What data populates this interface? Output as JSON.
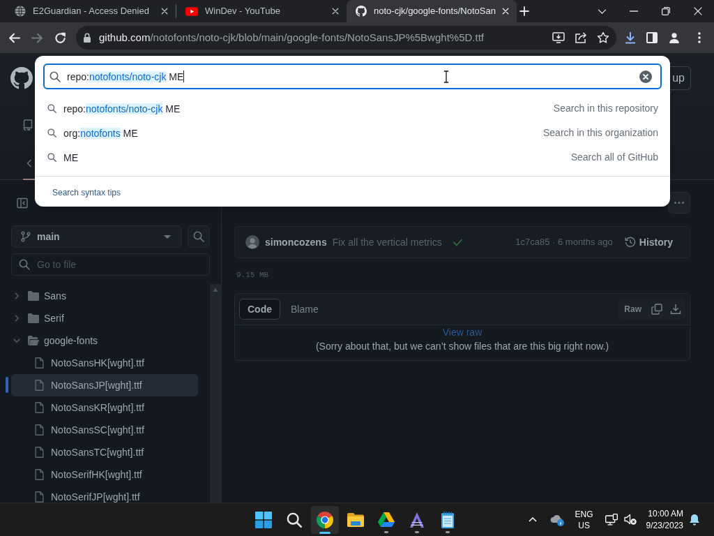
{
  "browser": {
    "tabs": [
      {
        "kind": "globe",
        "title": "E2Guardian - Access Denied",
        "selected": false
      },
      {
        "kind": "youtube",
        "title": "WinDev - YouTube",
        "selected": false
      },
      {
        "kind": "github",
        "title": "noto-cjk/google-fonts/NotoSan",
        "selected": true
      }
    ],
    "nav_buttons": [
      {
        "kind": "back",
        "disabled": false
      },
      {
        "kind": "forward",
        "disabled": true
      },
      {
        "kind": "reload",
        "disabled": false
      }
    ],
    "address": {
      "host": "github.com",
      "path": "/notofonts/noto-cjk/blob/main/google-fonts/NotoSansJP%5Bwght%5D.ttf"
    }
  },
  "header": {
    "signup_button": "up"
  },
  "search_popup": {
    "query_parts": [
      {
        "text": "repo:",
        "highlight": false
      },
      {
        "text": "notofonts/noto-cjk",
        "highlight": true
      },
      {
        "text": " ME",
        "highlight": false
      }
    ],
    "suggestions": [
      {
        "parts": [
          {
            "text": "repo:",
            "highlight": false
          },
          {
            "text": "notofonts/noto-cjk",
            "highlight": true
          },
          {
            "text": " ME",
            "highlight": false
          }
        ],
        "scope": "Search in this repository"
      },
      {
        "parts": [
          {
            "text": "org:",
            "highlight": false
          },
          {
            "text": "notofonts",
            "highlight": true
          },
          {
            "text": " ME",
            "highlight": false
          }
        ],
        "scope": "Search in this organization"
      },
      {
        "parts": [
          {
            "text": "ME",
            "highlight": false
          }
        ],
        "scope": "Search all of GitHub"
      }
    ],
    "syntax_tips": "Search syntax tips"
  },
  "sidebar": {
    "branch": "main",
    "file_filter": {
      "placeholder": "Go to file"
    },
    "tree": [
      {
        "kind": "folder",
        "name": "Sans",
        "expanded": false,
        "selected": false
      },
      {
        "kind": "folder",
        "name": "Serif",
        "expanded": false,
        "selected": false
      },
      {
        "kind": "folder",
        "name": "google-fonts",
        "expanded": true,
        "selected": false,
        "children": [
          {
            "kind": "file",
            "name": "NotoSansHK[wght].ttf",
            "selected": false
          },
          {
            "kind": "file",
            "name": "NotoSansJP[wght].ttf",
            "selected": true
          },
          {
            "kind": "file",
            "name": "NotoSansKR[wght].ttf",
            "selected": false
          },
          {
            "kind": "file",
            "name": "NotoSansSC[wght].ttf",
            "selected": false
          },
          {
            "kind": "file",
            "name": "NotoSansTC[wght].ttf",
            "selected": false
          },
          {
            "kind": "file",
            "name": "NotoSerifHK[wght].ttf",
            "selected": false
          },
          {
            "kind": "file",
            "name": "NotoSerifJP[wght].ttf",
            "selected": false
          }
        ]
      }
    ]
  },
  "file_view": {
    "commit": {
      "author": "simoncozens",
      "message": "Fix all the vertical metrics",
      "passed": true,
      "info": "1c7ca85 · 6 months ago",
      "history": "History"
    },
    "size": "9.15 MB",
    "view_tabs": [
      {
        "label": "Code",
        "selected": true
      },
      {
        "label": "Blame",
        "selected": false
      }
    ],
    "raw_button": "Raw",
    "view_raw": "View raw",
    "notice": "(Sorry about that, but we can’t show files that are this big right now.)"
  },
  "taskbar": {
    "apps": [
      {
        "kind": "start",
        "selected": false,
        "running": false
      },
      {
        "kind": "search",
        "selected": false,
        "running": false
      },
      {
        "kind": "chrome",
        "selected": true,
        "running": true
      },
      {
        "kind": "files",
        "selected": false,
        "running": false
      },
      {
        "kind": "drive",
        "selected": false,
        "running": true
      },
      {
        "kind": "triangle",
        "selected": false,
        "running": true
      },
      {
        "kind": "notepad",
        "selected": false,
        "running": true
      }
    ],
    "language": "ENG",
    "region": "US",
    "time": "10:00 AM",
    "date": "9/23/2023"
  }
}
